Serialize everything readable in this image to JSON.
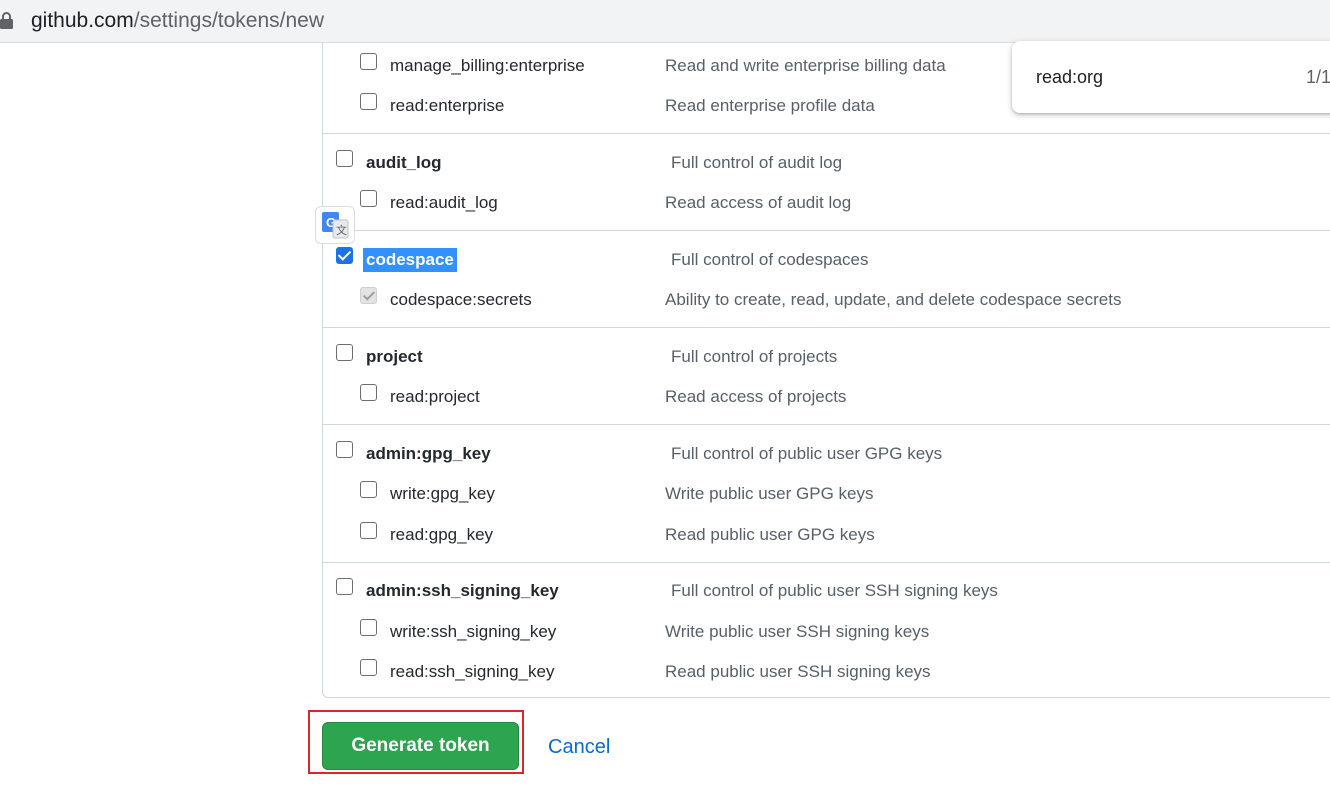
{
  "browser": {
    "url_host": "github.com",
    "url_path": "/settings/tokens/new"
  },
  "find_bar": {
    "query": "read:org",
    "count": "1/1"
  },
  "scopes": [
    {
      "name": "manage_billing:enterprise",
      "description": "Read and write enterprise billing data"
    },
    {
      "name": "read:enterprise",
      "description": "Read enterprise profile data"
    },
    {
      "name": "audit_log",
      "description": "Full control of audit log"
    },
    {
      "name": "read:audit_log",
      "description": "Read access of audit log"
    },
    {
      "name": "codespace",
      "description": "Full control of codespaces",
      "checked": true
    },
    {
      "name": "codespace:secrets",
      "description": "Ability to create, read, update, and delete codespace secrets",
      "checked": true
    },
    {
      "name": "project",
      "description": "Full control of projects"
    },
    {
      "name": "read:project",
      "description": "Read access of projects"
    },
    {
      "name": "admin:gpg_key",
      "description": "Full control of public user GPG keys"
    },
    {
      "name": "write:gpg_key",
      "description": "Write public user GPG keys"
    },
    {
      "name": "read:gpg_key",
      "description": "Read public user GPG keys"
    },
    {
      "name": "admin:ssh_signing_key",
      "description": "Full control of public user SSH signing keys"
    },
    {
      "name": "write:ssh_signing_key",
      "description": "Write public user SSH signing keys"
    },
    {
      "name": "read:ssh_signing_key",
      "description": "Read public user SSH signing keys"
    }
  ],
  "actions": {
    "generate_label": "Generate token",
    "cancel_label": "Cancel"
  },
  "icons": {
    "lock": "lock-icon",
    "translate": "google-translate-icon"
  },
  "colors": {
    "primary_button": "#2da44e",
    "link": "#0969da",
    "highlight_outline": "#e0242a",
    "selection": "#3390ff"
  }
}
